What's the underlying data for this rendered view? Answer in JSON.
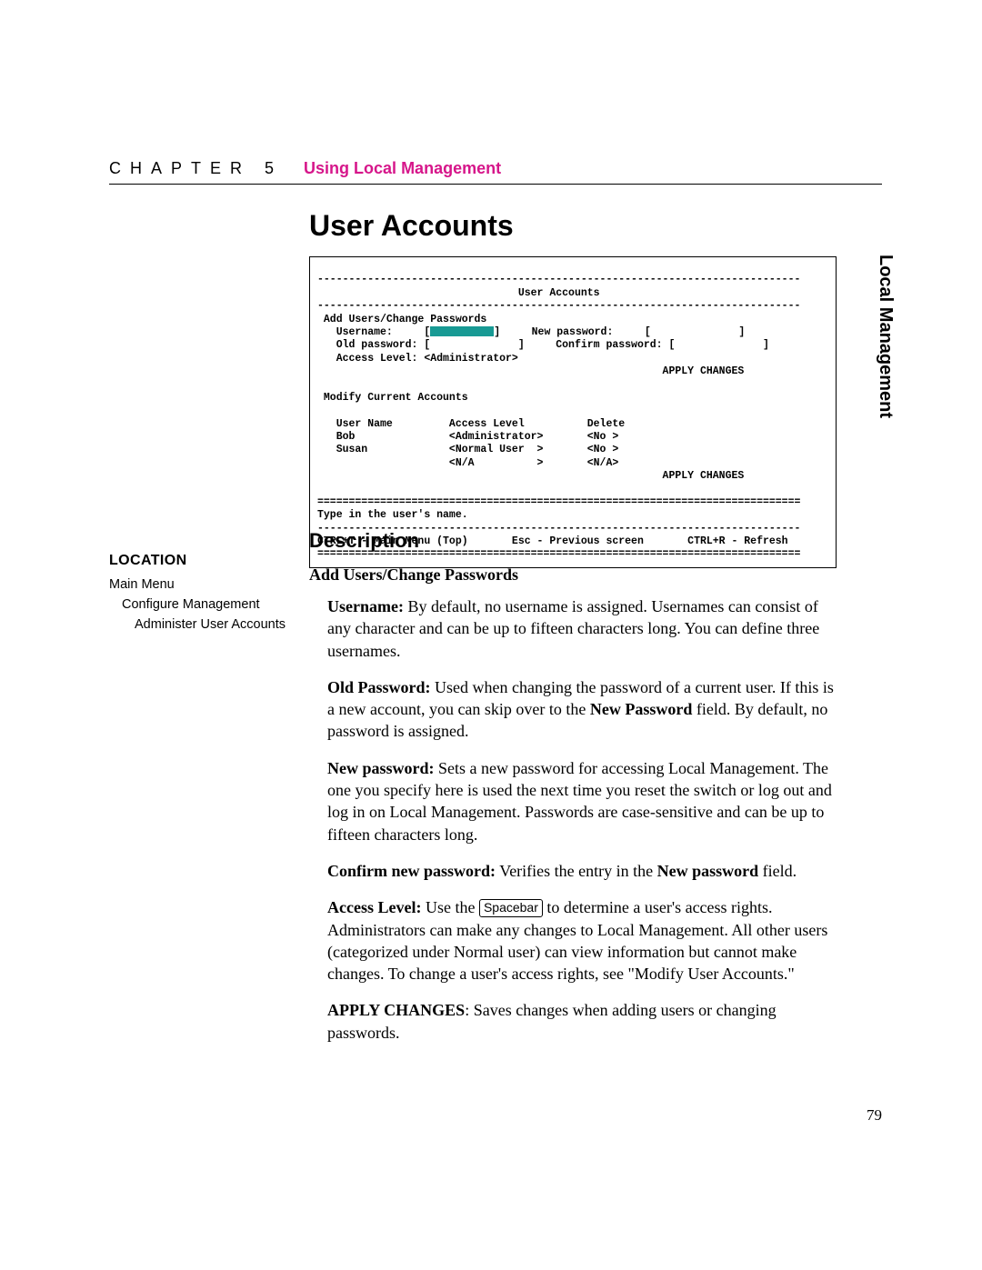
{
  "header": {
    "chapter_letters": "CHAPTER 5",
    "section": "Using Local Management"
  },
  "tab": "Local Management",
  "page_title": "User Accounts",
  "terminal": {
    "dash_top": "-----------------------------------------------------------------------------",
    "title": "User Accounts",
    "dash_sub": "-----------------------------------------------------------------------------",
    "section1": " Add Users/Change Passwords",
    "row_user_new_left": "   Username:     [",
    "row_user_new_right": "]     New password:     [              ]",
    "row_old_conf": "   Old password: [              ]     Confirm password: [              ]",
    "row_access": "   Access Level: <Administrator>",
    "apply1": "                                                       APPLY CHANGES",
    "section2": " Modify Current Accounts",
    "tbl_hdr": "   User Name         Access Level          Delete",
    "tbl_r1": "   Bob               <Administrator>       <No >",
    "tbl_r2": "   Susan             <Normal User  >       <No >",
    "tbl_r3": "                     <N/A          >       <N/A>",
    "apply2": "                                                       APPLY CHANGES",
    "eq_top": "=============================================================================",
    "hint": "Type in the user's name.",
    "dash_mid": "-----------------------------------------------------------------------------",
    "footer": "CTRL+T - Main Menu (Top)       Esc - Previous screen       CTRL+R - Refresh",
    "eq_bot": "============================================================================="
  },
  "location": {
    "heading": "LOCATION",
    "l1": "Main Menu",
    "l2": "Configure Management",
    "l3": "Administer User Accounts"
  },
  "desc": {
    "heading": "Description",
    "sub1": "Add Users/Change Passwords",
    "p1_lead": "Username:",
    "p1_body": " By default, no username is assigned. Usernames can consist of any character and can be up to fifteen characters long. You can define three usernames.",
    "p2_lead": "Old Password:",
    "p2_a": " Used when changing the password of a current user. If this is a new account, you can skip over to the ",
    "p2_bold": "New Password",
    "p2_b": " field. By default, no password is assigned.",
    "p3_lead": "New password:",
    "p3_body": " Sets a new password for accessing Local Management. The one you specify here is used the next time you reset the switch or log out and log in on Local Management. Passwords are case-sensitive and can be up to fifteen characters long.",
    "p4_lead": "Confirm new password:",
    "p4_a": " Verifies the entry in the ",
    "p4_bold": "New password",
    "p4_b": " field.",
    "p5_lead": "Access Level:",
    "p5_a": " Use the ",
    "p5_key": "Spacebar",
    "p5_b": " to determine a user's access rights. Administrators can make any changes to Local Management. All other users (categorized under Normal user) can view information but cannot make changes. To change a user's access rights, see \"Modify User Accounts.\"",
    "p6_lead": "APPLY CHANGES",
    "p6_body": ": Saves changes when adding users or changing passwords."
  },
  "page_number": "79"
}
